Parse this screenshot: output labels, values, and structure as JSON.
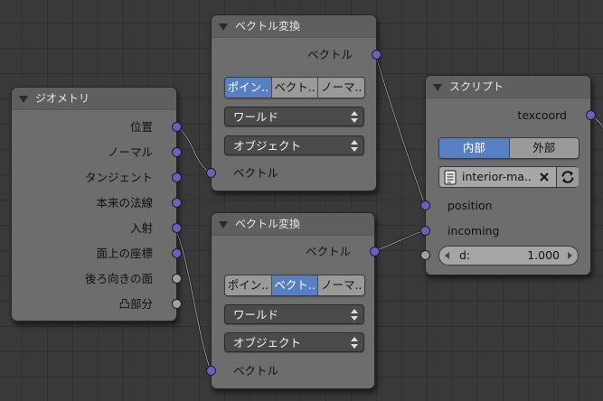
{
  "colors": {
    "vector_socket": "#6363c7",
    "shader_socket": "#a1a1a1",
    "active_segment": "#5680c2",
    "node_body": "#6d6d6d",
    "link": "#1b1b1b"
  },
  "geometry_node": {
    "title": "ジオメトリ",
    "outputs": [
      {
        "label": "位置"
      },
      {
        "label": "ノーマル"
      },
      {
        "label": "タンジェント"
      },
      {
        "label": "本来の法線"
      },
      {
        "label": "入射"
      },
      {
        "label": "面上の座標"
      },
      {
        "label": "後ろ向きの面"
      },
      {
        "label": "凸部分"
      }
    ]
  },
  "vector_transform_top": {
    "title": "ベクトル変換",
    "output_label": "ベクトル",
    "type_options": [
      "ポイン..",
      "ベクト..",
      "ノーマ.."
    ],
    "type_active": "ポイン..",
    "convert_from": "ワールド",
    "convert_to": "オブジェクト",
    "input_label": "ベクトル"
  },
  "vector_transform_bottom": {
    "title": "ベクトル変換",
    "output_label": "ベクトル",
    "type_options": [
      "ポイン..",
      "ベクト..",
      "ノーマ.."
    ],
    "type_active": "ベクト..",
    "convert_from": "ワールド",
    "convert_to": "オブジェクト",
    "input_label": "ベクトル"
  },
  "script_node": {
    "title": "スクリプト",
    "output_label": "texcoord",
    "mode_options": [
      "内部",
      "外部"
    ],
    "mode_active": "内部",
    "script_file": "interior-ma..",
    "inputs": {
      "position": "position",
      "incoming": "incoming"
    },
    "d_field": {
      "label": "d:",
      "value": "1.000"
    }
  }
}
